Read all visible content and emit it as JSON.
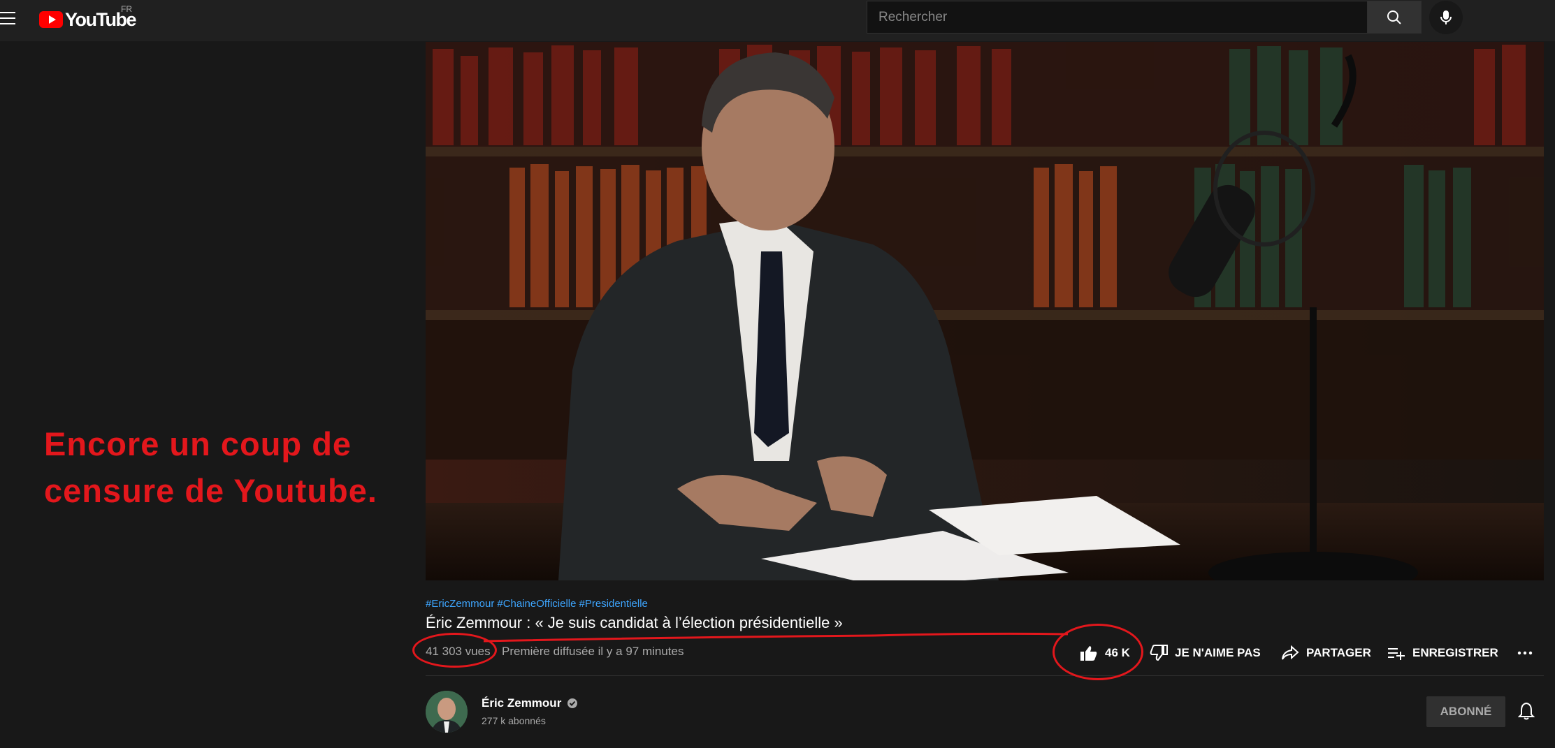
{
  "header": {
    "logo_text": "YouTube",
    "region": "FR",
    "search_placeholder": "Rechercher"
  },
  "annotation": {
    "text": "Encore un coup de censure de Youtube."
  },
  "video": {
    "hashtags": [
      "#EricZemmour",
      "#ChaineOfficielle",
      "#Presidentielle"
    ],
    "title": "Éric Zemmour : « Je suis candidat à l’élection présidentielle »",
    "views": "41 303 vues",
    "premiere": "Première diffusée il y a 97 minutes"
  },
  "actions": {
    "likes": "46 K",
    "dislike_label": "JE N'AIME PAS",
    "share_label": "PARTAGER",
    "save_label": "ENREGISTRER"
  },
  "channel": {
    "name": "Éric Zemmour",
    "subscribers": "277 k abonnés",
    "subscribe_label": "ABONNÉ"
  },
  "colors": {
    "background": "#181818",
    "topbar": "#202020",
    "accent_red": "#e3171c",
    "link_blue": "#3ea6ff",
    "youtube_red": "#ff0000"
  },
  "icons": [
    "menu-icon",
    "youtube-logo-icon",
    "search-icon",
    "mic-icon",
    "thumbs-up-icon",
    "thumbs-down-icon",
    "share-icon",
    "playlist-add-icon",
    "more-icon",
    "verified-icon",
    "bell-icon"
  ]
}
